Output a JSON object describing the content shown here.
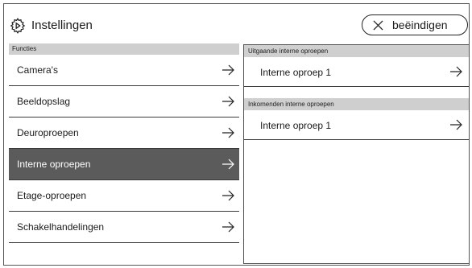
{
  "header": {
    "title": "Instellingen",
    "end_button": "beëindigen",
    "icons": {
      "settings": "gear-icon",
      "close": "close-icon"
    }
  },
  "left_panel": {
    "section_title": "Functies",
    "items": [
      {
        "label": "Camera's",
        "active": false
      },
      {
        "label": "Beeldopslag",
        "active": false
      },
      {
        "label": "Deuroproepen",
        "active": false
      },
      {
        "label": "Interne oproepen",
        "active": true
      },
      {
        "label": "Etage-oproepen",
        "active": false
      },
      {
        "label": "Schakelhandelingen",
        "active": false
      }
    ]
  },
  "right_panel": {
    "outgoing": {
      "title": "Uitgaande interne oproepen",
      "items": [
        {
          "label": "Interne oproep 1"
        }
      ]
    },
    "incoming": {
      "title": "Inkomenden interne oproepen",
      "items": [
        {
          "label": "Interne oproep 1"
        }
      ]
    }
  },
  "colors": {
    "active_item_bg": "#5b5b5b",
    "section_header_bg": "#cfcfcf",
    "border": "#555555"
  }
}
